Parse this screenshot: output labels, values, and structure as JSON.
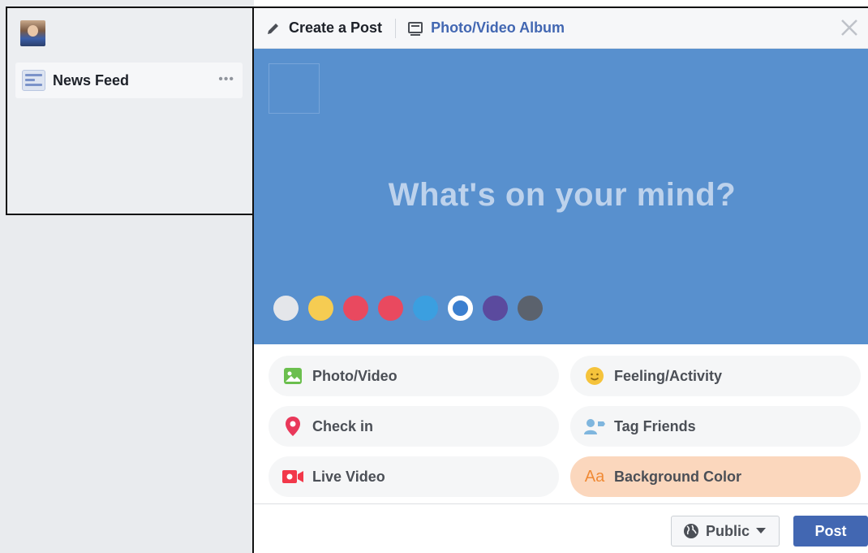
{
  "sidebar": {
    "news_feed_label": "News Feed",
    "more_label": "•••"
  },
  "composer": {
    "tabs": {
      "create_post": "Create a Post",
      "photo_album": "Photo/Video Album"
    },
    "prompt": "What's on your mind?",
    "background_colors": [
      "#e4e6ea",
      "#f6cc52",
      "#e9495f",
      "#e9495f",
      "#3b9fe0",
      "#3b7fcf",
      "#5b4a9e",
      "#5b626d"
    ],
    "selected_color_index": 5,
    "options": {
      "photo_video": "Photo/Video",
      "feeling_activity": "Feeling/Activity",
      "check_in": "Check in",
      "tag_friends": "Tag Friends",
      "live_video": "Live Video",
      "background_color": "Background Color",
      "background_color_icon_text": "Aa"
    },
    "footer": {
      "audience": "Public",
      "post": "Post"
    }
  },
  "colors": {
    "brand_blue": "#4267b2",
    "canvas_blue": "#5890ce",
    "active_option": "#fbd7bd"
  }
}
